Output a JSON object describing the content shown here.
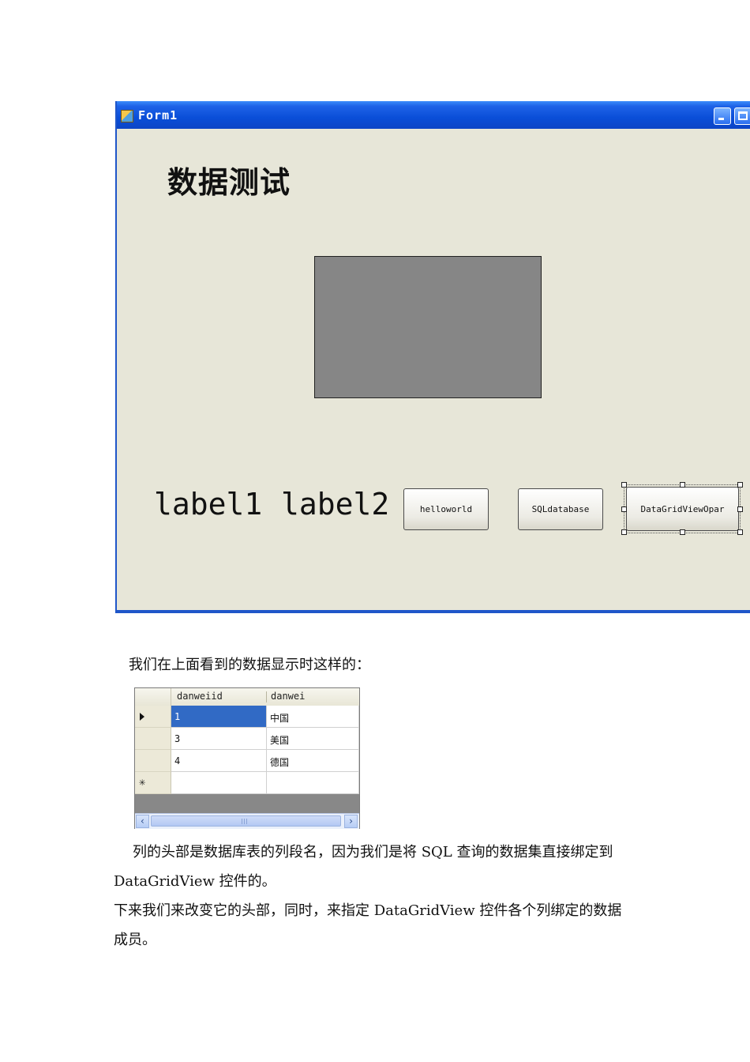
{
  "form": {
    "title": "Form1",
    "heading": "数据测试",
    "label1": "label1",
    "label2": "label2",
    "buttons": {
      "helloworld": "helloworld",
      "sqldatabase": "SQLdatabase",
      "datagridview": "DataGridViewOpar"
    }
  },
  "doc": {
    "intro": "我们在上面看到的数据显示时这样的：",
    "para2_line1": "列的头部是数据库表的列段名，因为我们是将 SQL 查询的数据集直接绑定到",
    "para2_line2": "DataGridView 控件的。",
    "para3_line1": "下来我们来改变它的头部，同时，来指定 DataGridView 控件各个列绑定的数据",
    "para3_line2": "成员。"
  },
  "grid": {
    "columns": [
      "danweiid",
      "danwei"
    ],
    "rows": [
      [
        "1",
        "中国"
      ],
      [
        "3",
        "美国"
      ],
      [
        "4",
        "德国"
      ]
    ],
    "new_row_marker": "✳"
  },
  "icons": {
    "app": "form-app-icon",
    "current_row": "row-pointer-icon",
    "new_row": "new-row-asterisk-icon"
  },
  "colors": {
    "titlebar": "#0a4ed8",
    "form_bg": "#e7e6d8",
    "selection": "#316ac5"
  }
}
